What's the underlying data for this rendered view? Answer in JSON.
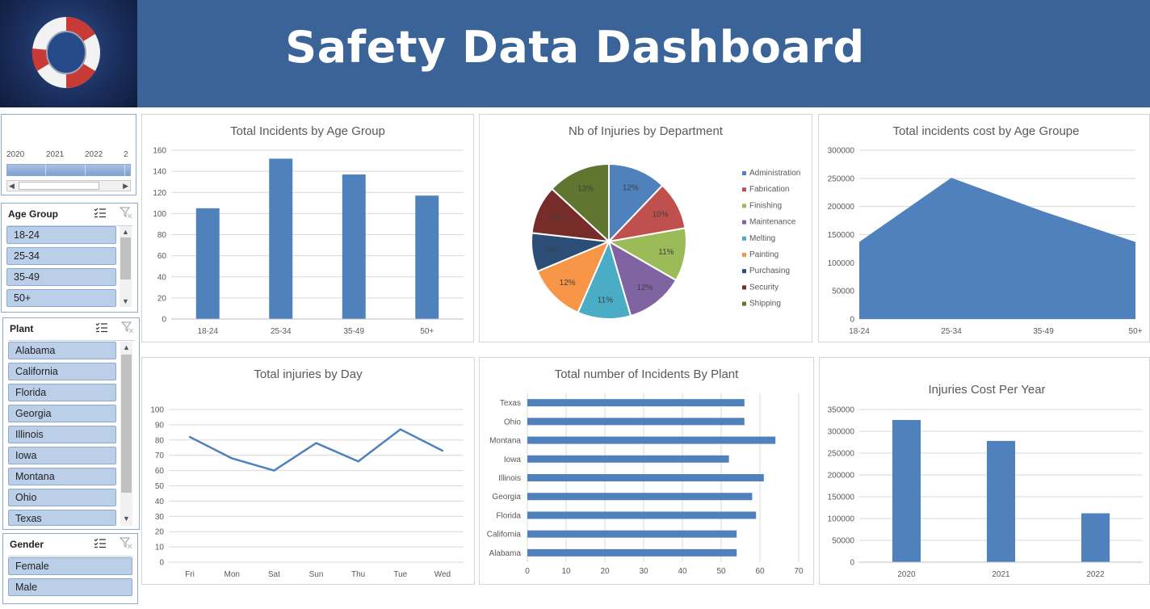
{
  "header": {
    "title": "Safety Data Dashboard"
  },
  "timeline": {
    "years": [
      "2020",
      "2021",
      "2022",
      "2"
    ]
  },
  "slicers": {
    "age_group": {
      "title": "Age Group",
      "items": [
        "18-24",
        "25-34",
        "35-49",
        "50+"
      ]
    },
    "plant": {
      "title": "Plant",
      "items": [
        "Alabama",
        "California",
        "Florida",
        "Georgia",
        "Illinois",
        "Iowa",
        "Montana",
        "Ohio",
        "Texas"
      ]
    },
    "gender": {
      "title": "Gender",
      "items": [
        "Female",
        "Male"
      ]
    }
  },
  "colors": {
    "accent": "#4f81bd",
    "header": "#3a6397",
    "gridline": "#d9d9d9"
  },
  "chart_data": [
    {
      "id": "age-bar",
      "type": "bar",
      "title": "Total Incidents by Age Group",
      "categories": [
        "18-24",
        "25-34",
        "35-49",
        "50+"
      ],
      "values": [
        105,
        152,
        137,
        117
      ],
      "ylim": [
        0,
        160
      ],
      "yticks": [
        0,
        20,
        40,
        60,
        80,
        100,
        120,
        140,
        160
      ],
      "grid": true
    },
    {
      "id": "dept-pie",
      "type": "pie",
      "title": "Nb of Injuries by Department",
      "categories": [
        "Administration",
        "Fabrication",
        "Finishing",
        "Maintenance",
        "Melting",
        "Painting",
        "Purchasing",
        "Security",
        "Shipping"
      ],
      "values": [
        12,
        10,
        11,
        12,
        11,
        12,
        8,
        10,
        13
      ],
      "labels": [
        "12%",
        "10%",
        "11%",
        "12%",
        "11%",
        "12%",
        "8%",
        "10%",
        "13%"
      ],
      "colors": [
        "#4f81bd",
        "#c0504d",
        "#9bbb59",
        "#8064a2",
        "#4bacc6",
        "#f79646",
        "#2c4d75",
        "#772c2a",
        "#5f7530"
      ],
      "legend": "right"
    },
    {
      "id": "cost-area",
      "type": "area",
      "title": "Total incidents cost by Age Groupe",
      "categories": [
        "18-24",
        "25-34",
        "35-49",
        "50+"
      ],
      "values": [
        137000,
        251000,
        191000,
        137000
      ],
      "ylim": [
        0,
        300000
      ],
      "yticks": [
        0,
        50000,
        100000,
        150000,
        200000,
        250000,
        300000
      ],
      "grid": true
    },
    {
      "id": "day-line",
      "type": "line",
      "title": "Total injuries by Day",
      "categories": [
        "Fri",
        "Mon",
        "Sat",
        "Sun",
        "Thu",
        "Tue",
        "Wed"
      ],
      "values": [
        82,
        68,
        60,
        78,
        66,
        87,
        73
      ],
      "ylim": [
        0,
        100
      ],
      "yticks": [
        0,
        10,
        20,
        30,
        40,
        50,
        60,
        70,
        80,
        90,
        100
      ],
      "grid": true
    },
    {
      "id": "plant-hbar",
      "type": "bar",
      "orientation": "horizontal",
      "title": "Total number of Incidents By Plant",
      "categories": [
        "Alabama",
        "California",
        "Florida",
        "Georgia",
        "Illinois",
        "Iowa",
        "Montana",
        "Ohio",
        "Texas"
      ],
      "values": [
        54,
        54,
        59,
        58,
        61,
        52,
        64,
        56,
        56
      ],
      "xlim": [
        0,
        70
      ],
      "xticks": [
        0,
        10,
        20,
        30,
        40,
        50,
        60,
        70
      ],
      "grid": true
    },
    {
      "id": "year-bar",
      "type": "bar",
      "title": "Injuries Cost Per Year",
      "categories": [
        "2020",
        "2021",
        "2022"
      ],
      "values": [
        326000,
        278000,
        112000
      ],
      "ylim": [
        0,
        350000
      ],
      "yticks": [
        0,
        50000,
        100000,
        150000,
        200000,
        250000,
        300000,
        350000
      ],
      "grid": true
    }
  ]
}
